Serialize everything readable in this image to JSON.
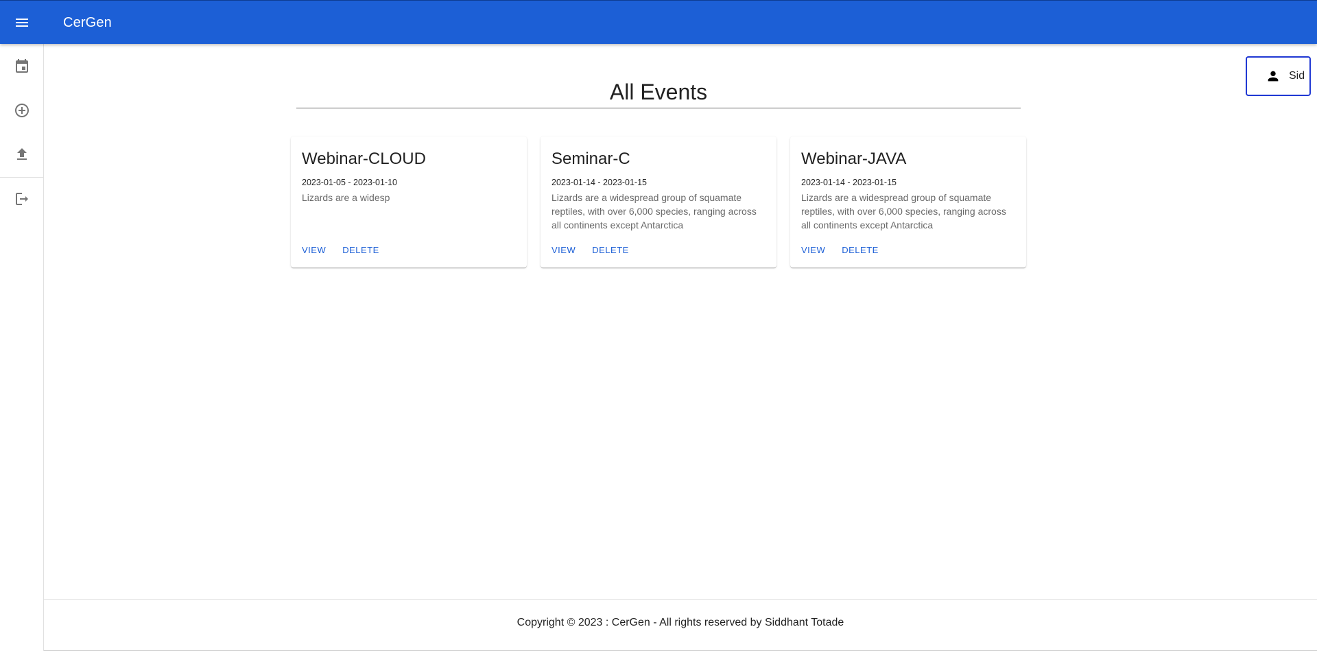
{
  "theme": {
    "primary": "#1c5fd6",
    "user_button_border": "#2038d3"
  },
  "appbar": {
    "title": "CerGen",
    "menu_icon": "menu-icon"
  },
  "sidebar": {
    "items": [
      {
        "name": "calendar",
        "icon": "calendar-icon"
      },
      {
        "name": "add-event",
        "icon": "add-circle-icon"
      },
      {
        "name": "upload",
        "icon": "upload-icon"
      },
      {
        "name": "logout",
        "icon": "logout-icon"
      }
    ]
  },
  "user": {
    "label": "Sid",
    "icon": "person-icon"
  },
  "main": {
    "title": "All Events"
  },
  "events": [
    {
      "title": "Webinar-CLOUD",
      "dates": "2023-01-05 - 2023-01-10",
      "description": "Lizards are a widesp",
      "view_label": "VIEW",
      "delete_label": "DELETE"
    },
    {
      "title": "Seminar-C",
      "dates": "2023-01-14 - 2023-01-15",
      "description": "Lizards are a widespread group of squamate reptiles, with over 6,000 species, ranging across all continents except Antarctica",
      "view_label": "VIEW",
      "delete_label": "DELETE"
    },
    {
      "title": "Webinar-JAVA",
      "dates": "2023-01-14 - 2023-01-15",
      "description": "Lizards are a widespread group of squamate reptiles, with over 6,000 species, ranging across all continents except Antarctica",
      "view_label": "VIEW",
      "delete_label": "DELETE"
    }
  ],
  "footer": {
    "text": "Copyright © 2023 : CerGen - All rights reserved by Siddhant Totade"
  }
}
